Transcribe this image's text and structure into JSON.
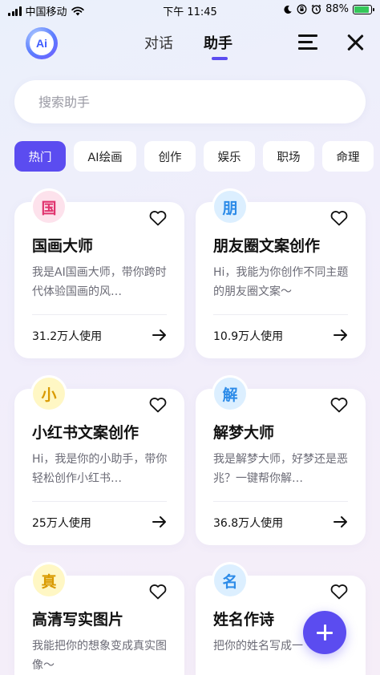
{
  "status_bar": {
    "carrier": "中国移动",
    "time": "下午 11:45",
    "battery_percent": "88%",
    "battery_level": 0.88,
    "icons": [
      "signal-icon",
      "wifi-icon",
      "moon-icon",
      "orientation-lock-icon",
      "alarm-icon",
      "battery-charging-icon"
    ]
  },
  "header": {
    "logo_text": "Ai",
    "tabs": [
      {
        "label": "对话",
        "active": false
      },
      {
        "label": "助手",
        "active": true
      }
    ],
    "icons": [
      "menu-icon",
      "close-icon"
    ]
  },
  "search": {
    "placeholder": "搜索助手"
  },
  "categories": [
    {
      "label": "热门",
      "active": true
    },
    {
      "label": "AI绘画",
      "active": false
    },
    {
      "label": "创作",
      "active": false
    },
    {
      "label": "娱乐",
      "active": false
    },
    {
      "label": "职场",
      "active": false
    },
    {
      "label": "命理",
      "active": false
    }
  ],
  "cards": [
    {
      "badge": "国",
      "title": "国画大师",
      "desc": "我是AI国画大师，带你跨时代体验国画的风…",
      "usage": "31.2万人使用",
      "badge_bg": "#fde2ec",
      "badge_color": "#e0336e"
    },
    {
      "badge": "朋",
      "title": "朋友圈文案创作",
      "desc": "Hi，我能为你创作不同主题的朋友圈文案～",
      "usage": "10.9万人使用",
      "badge_bg": "#dcefff",
      "badge_color": "#2c8be8"
    },
    {
      "badge": "小",
      "title": "小红书文案创作",
      "desc": "Hi，我是你的小助手，带你轻松创作小红书…",
      "usage": "25万人使用",
      "badge_bg": "#fff7c4",
      "badge_color": "#d99a00"
    },
    {
      "badge": "解",
      "title": "解梦大师",
      "desc": "我是解梦大师，好梦还是恶兆？一键帮你解…",
      "usage": "36.8万人使用",
      "badge_bg": "#dcefff",
      "badge_color": "#2c8be8"
    },
    {
      "badge": "真",
      "title": "高清写实图片",
      "desc": "我能把你的想象变成真实图像～",
      "usage": "",
      "badge_bg": "#fff7c4",
      "badge_color": "#d99a00"
    },
    {
      "badge": "名",
      "title": "姓名作诗",
      "desc": "把你的姓名写成一",
      "usage": "",
      "badge_bg": "#dcefff",
      "badge_color": "#2c8be8"
    }
  ],
  "colors": {
    "accent": "#5b4cf0"
  },
  "fab": {
    "icon": "plus-icon"
  }
}
